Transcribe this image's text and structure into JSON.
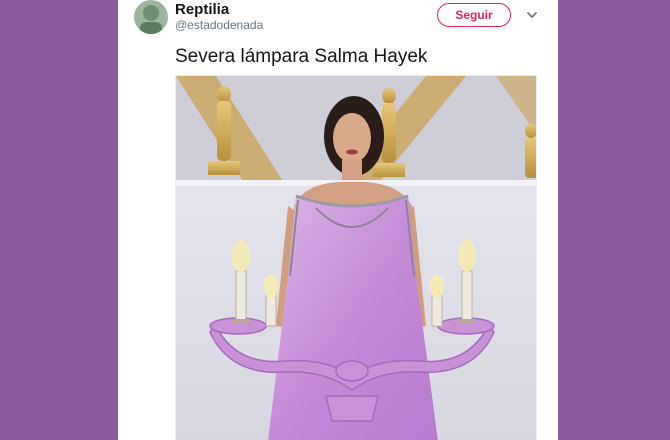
{
  "tweet": {
    "author_name": "Reptilia",
    "author_handle": "@estadodenada",
    "follow_label": "Seguir",
    "text": "Severa lámpara Salma Hayek"
  },
  "colors": {
    "page_background": "#8a5b9d",
    "card_background": "#ffffff",
    "follow_accent": "#e0245e",
    "handle_gray": "#657786"
  },
  "icons": [
    "avatar",
    "chevron-down-icon"
  ]
}
